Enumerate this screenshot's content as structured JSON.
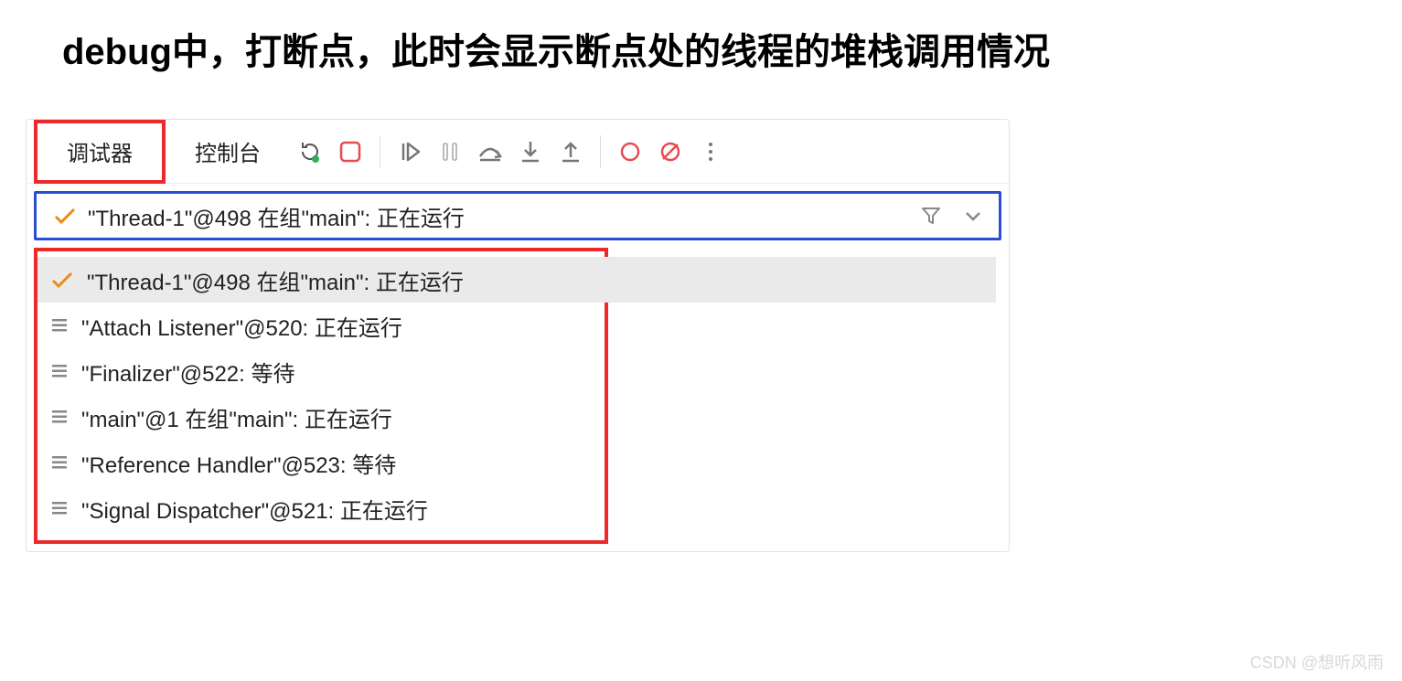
{
  "heading": "debug中，打断点，此时会显示断点处的线程的堆栈调用情况",
  "tabs": {
    "debugger": "调试器",
    "console": "控制台"
  },
  "current_thread": {
    "label": "\"Thread-1\"@498 在组\"main\": 正在运行"
  },
  "threads": [
    {
      "icon": "check",
      "label": "\"Thread-1\"@498 在组\"main\": 正在运行",
      "selected": true
    },
    {
      "icon": "lines",
      "label": "\"Attach Listener\"@520: 正在运行",
      "selected": false
    },
    {
      "icon": "lines",
      "label": "\"Finalizer\"@522: 等待",
      "selected": false
    },
    {
      "icon": "lines",
      "label": "\"main\"@1 在组\"main\": 正在运行",
      "selected": false
    },
    {
      "icon": "lines",
      "label": "\"Reference Handler\"@523: 等待",
      "selected": false
    },
    {
      "icon": "lines",
      "label": "\"Signal Dispatcher\"@521: 正在运行",
      "selected": false
    }
  ],
  "colors": {
    "annotation_red": "#ec2a2a",
    "annotation_blue": "#2a4dd6"
  },
  "watermark": "CSDN @想听风雨"
}
